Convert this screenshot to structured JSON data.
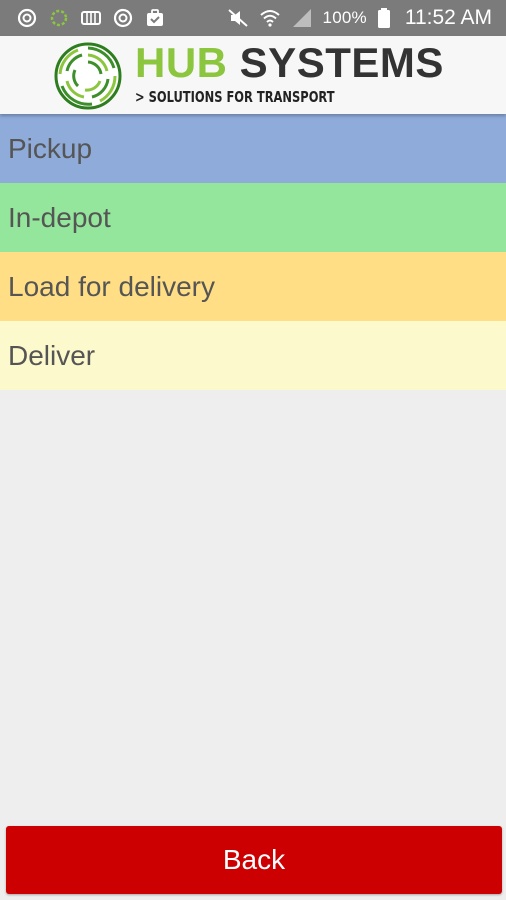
{
  "status_bar": {
    "left_icons": [
      "sync-icon",
      "loading-ring-icon",
      "sim-card-icon",
      "sync-icon",
      "clipboard-icon"
    ],
    "right_icons": [
      "mute-icon",
      "wifi-icon",
      "signal-icon"
    ],
    "battery_percent": "100%",
    "battery_icon": "battery-icon",
    "time": "11:52 AM"
  },
  "header": {
    "logo_icon": "hub-systems-logo-icon",
    "brand_word_1": "HUB",
    "brand_word_2": "SYSTEMS",
    "tagline": "> SOLUTIONS FOR TRANSPORT",
    "colors": {
      "brand_green": "#8cc63f",
      "brand_dark": "#333333"
    }
  },
  "menu": {
    "items": [
      {
        "label": "Pickup",
        "color": "#8fabd9"
      },
      {
        "label": "In-depot",
        "color": "#93e69b"
      },
      {
        "label": "Load for delivery",
        "color": "#ffde85"
      },
      {
        "label": "Deliver",
        "color": "#fcf9cc"
      }
    ]
  },
  "footer": {
    "back_label": "Back",
    "back_color": "#cc0000"
  }
}
